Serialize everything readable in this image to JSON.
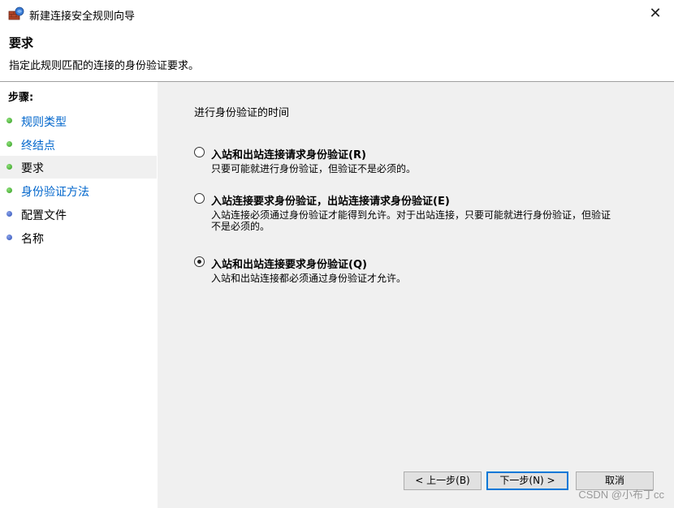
{
  "window": {
    "title": "新建连接安全规则向导",
    "close_glyph": "✕"
  },
  "header": {
    "title": "要求",
    "subtitle": "指定此规则匹配的连接的身份验证要求。"
  },
  "sidebar": {
    "steps_title": "步骤:",
    "items": [
      {
        "label": "规则类型",
        "state": "done"
      },
      {
        "label": "终结点",
        "state": "done"
      },
      {
        "label": "要求",
        "state": "current"
      },
      {
        "label": "身份验证方法",
        "state": "done"
      },
      {
        "label": "配置文件",
        "state": "pending"
      },
      {
        "label": "名称",
        "state": "pending"
      }
    ]
  },
  "main": {
    "question": "进行身份验证的时间",
    "options": [
      {
        "label": "入站和出站连接请求身份验证(R)",
        "desc": "只要可能就进行身份验证，但验证不是必须的。",
        "checked": false
      },
      {
        "label": "入站连接要求身份验证，出站连接请求身份验证(E)",
        "desc": "入站连接必须通过身份验证才能得到允许。对于出站连接，只要可能就进行身份验证，但验证不是必须的。",
        "checked": false
      },
      {
        "label": "入站和出站连接要求身份验证(Q)",
        "desc": "入站和出站连接都必须通过身份验证才允许。",
        "checked": true
      }
    ]
  },
  "buttons": {
    "back": "< 上一步(B)",
    "next": "下一步(N) >",
    "cancel": "取消"
  },
  "watermark": "CSDN @小布丁cc",
  "colors": {
    "link": "#0066cc",
    "done_dot": "#2e9b1e",
    "pending_dot": "#2c4fb8",
    "content_bg": "#f0f0f0"
  }
}
